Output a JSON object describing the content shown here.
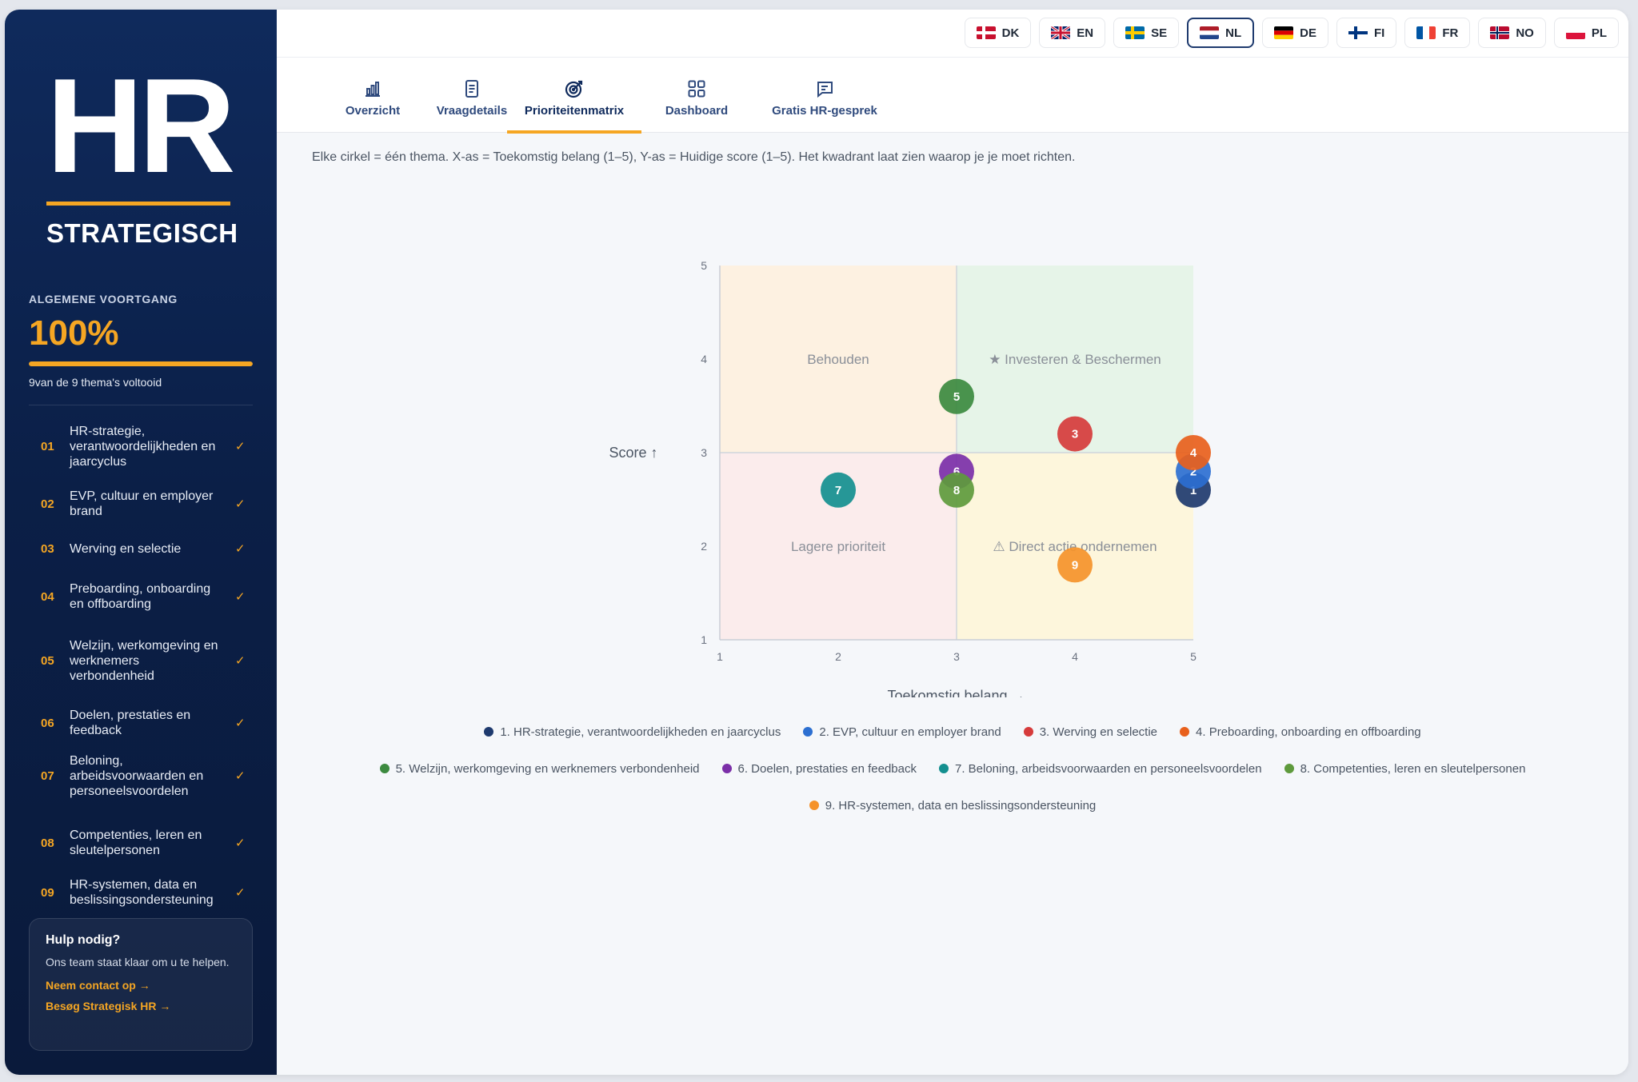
{
  "sidebar": {
    "logo_main": "HR",
    "logo_sub": "STRATEGISCH",
    "progress_label": "ALGEMENE VOORTGANG",
    "progress_value": "100%",
    "progress_fraction": 1.0,
    "progress_count": "9van de 9 thema's voltooid",
    "themes": [
      {
        "num": "01",
        "label": "HR-strategie, verantwoordelijkheden en jaarcyclus",
        "check": "✓"
      },
      {
        "num": "02",
        "label": "EVP, cultuur en employer brand",
        "check": "✓"
      },
      {
        "num": "03",
        "label": "Werving en selectie",
        "check": "✓"
      },
      {
        "num": "04",
        "label": "Preboarding, onboarding en offboarding",
        "check": "✓"
      },
      {
        "num": "05",
        "label": "Welzijn, werkomgeving en werknemers verbondenheid",
        "check": "✓"
      },
      {
        "num": "06",
        "label": "Doelen, prestaties en feedback",
        "check": "✓"
      },
      {
        "num": "07",
        "label": "Beloning, arbeidsvoorwaarden en personeelsvoordelen",
        "check": "✓"
      },
      {
        "num": "08",
        "label": "Competenties, leren en sleutelpersonen",
        "check": "✓"
      },
      {
        "num": "09",
        "label": "HR-systemen, data en beslissingsondersteuning",
        "check": "✓"
      }
    ],
    "help": {
      "title": "Hulp nodig?",
      "text": "Ons team staat klaar om u te helpen.",
      "link_contact": "Neem contact op →",
      "link_visit": "Besøg Strategisk HR →"
    }
  },
  "languages": [
    {
      "code": "DK",
      "flag": "dk",
      "active": false
    },
    {
      "code": "EN",
      "flag": "gb",
      "active": false
    },
    {
      "code": "SE",
      "flag": "se",
      "active": false
    },
    {
      "code": "NL",
      "flag": "nl",
      "active": true
    },
    {
      "code": "DE",
      "flag": "de",
      "active": false
    },
    {
      "code": "FI",
      "flag": "fi",
      "active": false
    },
    {
      "code": "FR",
      "flag": "fr",
      "active": false
    },
    {
      "code": "NO",
      "flag": "no",
      "active": false
    },
    {
      "code": "PL",
      "flag": "pl",
      "active": false
    }
  ],
  "tabs": [
    {
      "label": "Overzicht",
      "icon": "bar-chart-icon",
      "active": false
    },
    {
      "label": "Vraagdetails",
      "icon": "document-icon",
      "active": false
    },
    {
      "label": "Prioriteitenmatrix",
      "icon": "target-icon",
      "active": true
    },
    {
      "label": "Dashboard",
      "icon": "grid-icon",
      "active": false
    },
    {
      "label": "Gratis HR-gesprek",
      "icon": "chat-icon",
      "active": false
    }
  ],
  "description": "Elke cirkel = één thema. X-as = Toekomstig belang (1–5), Y-as = Huidige score (1–5). Het kwadrant laat zien waarop je je moet richten.",
  "chart_data": {
    "type": "scatter",
    "xlabel": "Toekomstig belang →",
    "ylabel": "Score ↑",
    "xlim": [
      1,
      5
    ],
    "ylim": [
      1,
      5
    ],
    "xticks": [
      "1",
      "2",
      "3",
      "4",
      "5"
    ],
    "yticks": [
      "1",
      "2",
      "3",
      "4",
      "5"
    ],
    "quadrants": [
      {
        "label": "Behouden",
        "position": "top-left",
        "color": "#fdf1e1"
      },
      {
        "label": "★ Investeren & Beschermen",
        "position": "top-right",
        "color": "#e6f4e8"
      },
      {
        "label": "Lagere prioriteit",
        "position": "bottom-left",
        "color": "#fbecec"
      },
      {
        "label": "⚠ Direct actie ondernemen",
        "position": "bottom-right",
        "color": "#fdf6dc"
      }
    ],
    "points": [
      {
        "id": "1",
        "name": "1. HR-strategie, verantwoordelijkheden en jaarcyclus",
        "x": 5,
        "y": 2.6,
        "color": "#1e3a6e"
      },
      {
        "id": "2",
        "name": "2. EVP, cultuur en employer brand",
        "x": 5,
        "y": 2.8,
        "color": "#2c6fd1"
      },
      {
        "id": "3",
        "name": "3. Werving en selectie",
        "x": 4,
        "y": 3.2,
        "color": "#d63b3b"
      },
      {
        "id": "4",
        "name": "4. Preboarding, onboarding en offboarding",
        "x": 5,
        "y": 3.0,
        "color": "#e8601c"
      },
      {
        "id": "5",
        "name": "5. Welzijn, werkomgeving en werknemers verbondenheid",
        "x": 3,
        "y": 3.6,
        "color": "#3c8a3f"
      },
      {
        "id": "6",
        "name": "6. Doelen, prestaties en feedback",
        "x": 3,
        "y": 2.8,
        "color": "#7b2fa8"
      },
      {
        "id": "7",
        "name": "7. Beloning, arbeidsvoorwaarden en personeelsvoordelen",
        "x": 2,
        "y": 2.6,
        "color": "#138f8f"
      },
      {
        "id": "8",
        "name": "8. Competenties, leren en sleutelpersonen",
        "x": 3,
        "y": 2.6,
        "color": "#5e9a3c"
      },
      {
        "id": "9",
        "name": "9. HR-systemen, data en beslissingsondersteuning",
        "x": 4,
        "y": 1.8,
        "color": "#f5922a"
      }
    ]
  }
}
